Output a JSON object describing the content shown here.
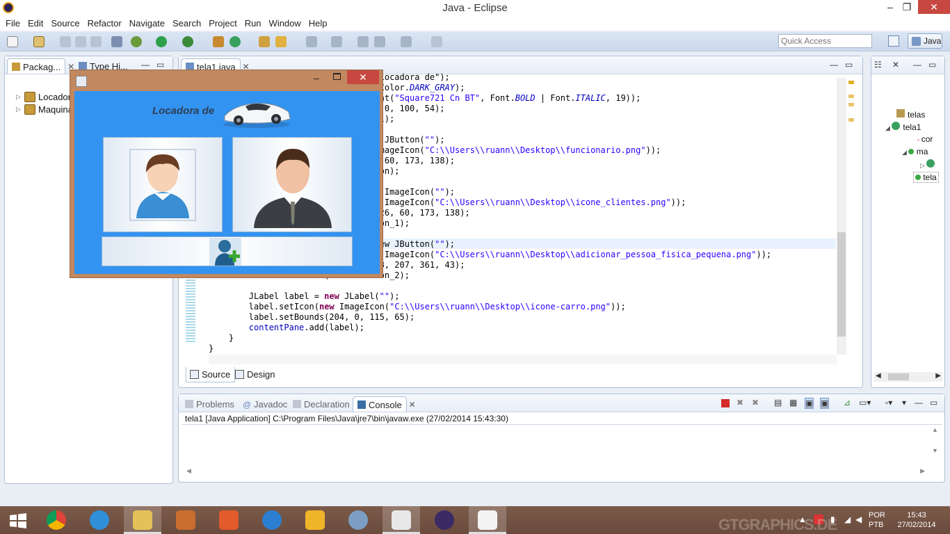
{
  "window": {
    "title": "Java - Eclipse",
    "minimize": "–",
    "restore": "❐",
    "close": "✕"
  },
  "menu": [
    "File",
    "Edit",
    "Source",
    "Refactor",
    "Navigate",
    "Search",
    "Project",
    "Run",
    "Window",
    "Help"
  ],
  "toolbar": {
    "quick_access_placeholder": "Quick Access",
    "perspective": "Java"
  },
  "package_explorer": {
    "tabs": [
      {
        "label": "Packag..."
      },
      {
        "label": "Type Hi..."
      }
    ],
    "items": [
      {
        "label": "Locadora"
      },
      {
        "label": "Maquina"
      }
    ]
  },
  "editor": {
    "tab_label": "tela1.java",
    "bottom_tabs": [
      "Source",
      "Design"
    ]
  },
  "outline": {
    "items": [
      "telas",
      "tela1",
      "cor",
      "ma",
      "tela"
    ]
  },
  "console": {
    "tabs": [
      "Problems",
      "Javadoc",
      "Declaration",
      "Console"
    ],
    "header": "tela1 [Java Application] C:\\Program Files\\Java\\jre7\\bin\\javaw.exe (27/02/2014 15:43:30)"
  },
  "swing_window": {
    "label": "Locadora de",
    "close": "✕",
    "minimize": "–"
  },
  "taskbar": {
    "lang_line1": "POR",
    "lang_line2": "PTB",
    "time": "15:43",
    "date": "27/02/2014",
    "watermark": "GTGRAPHICS.DE"
  },
  "colors": {
    "accent": "#3393f0",
    "toolbar": "#cbd9ec",
    "taskbar": "#6a4b3c",
    "close": "#c74840"
  }
}
